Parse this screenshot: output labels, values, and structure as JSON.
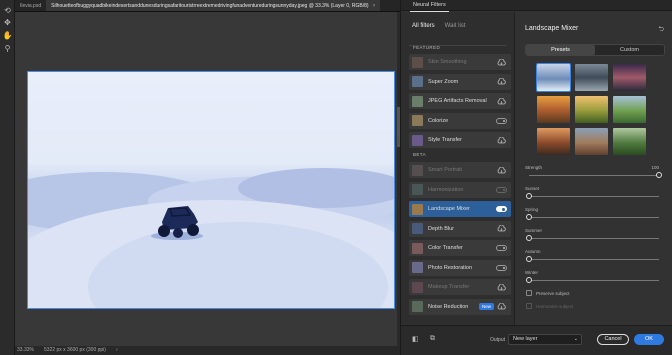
{
  "document": {
    "tabs": [
      {
        "label": "Ilevia.psd"
      },
      {
        "label": "Silhouetteofbuggyquadbikeindesertsanddunesduringsafaritouristrreextremedrivingfunadventureduringsunnyday.jpeg @ 33.3% (Layer 0, RGB/8)",
        "close": "×"
      }
    ],
    "status": {
      "zoom": "33.33%",
      "size": "5322 px x 3600 px (300 ppi)"
    }
  },
  "tools": [
    "canvas-rotate-icon",
    "move-icon",
    "hand-icon",
    "zoom-icon"
  ],
  "panel": {
    "tab": "Neural Filters",
    "list_tabs": {
      "all": "All filters",
      "wait": "Wait list"
    },
    "featured_header": "FEATURED",
    "beta_header": "BETA",
    "featured": [
      {
        "label": "Skin Smoothing",
        "dim": true,
        "control": "cloud"
      },
      {
        "label": "Super Zoom",
        "dim": false,
        "control": "cloud"
      },
      {
        "label": "JPEG Artifacts Removal",
        "dim": false,
        "control": "cloud"
      },
      {
        "label": "Colorize",
        "dim": false,
        "control": "toggle-off"
      },
      {
        "label": "Style Transfer",
        "dim": false,
        "control": "cloud"
      }
    ],
    "beta": [
      {
        "label": "Smart Portrait",
        "dim": true,
        "control": "cloud"
      },
      {
        "label": "Harmonization",
        "dim": true,
        "control": "toggle-off"
      },
      {
        "label": "Landscape Mixer",
        "dim": false,
        "control": "toggle-on",
        "selected": true
      },
      {
        "label": "Depth Blur",
        "dim": false,
        "control": "cloud"
      },
      {
        "label": "Color Transfer",
        "dim": false,
        "control": "toggle-off"
      },
      {
        "label": "Photo Restoration",
        "dim": false,
        "control": "toggle-off"
      },
      {
        "label": "Makeup Transfer",
        "dim": true,
        "control": "cloud"
      },
      {
        "label": "Noise Reduction",
        "dim": false,
        "control": "badge",
        "badge": "New"
      }
    ]
  },
  "settings": {
    "title": "Landscape Mixer",
    "segments": {
      "presets": "Presets",
      "custom": "Custom"
    },
    "presets_selected": 0,
    "sliders": [
      {
        "label": "Strength",
        "value": "100",
        "level": 1.0
      },
      {
        "label": "Sunset",
        "value": "",
        "level": 0.0
      },
      {
        "label": "Spring",
        "value": "",
        "level": 0.0
      },
      {
        "label": "Summer",
        "value": "",
        "level": 0.0
      },
      {
        "label": "Autumn",
        "value": "",
        "level": 0.0
      },
      {
        "label": "Winter",
        "value": "",
        "level": 0.0
      }
    ],
    "checkboxes": [
      {
        "label": "Preserve subject",
        "checked": false
      },
      {
        "label": "Harmonize subject",
        "checked": false,
        "disabled": true
      }
    ]
  },
  "bottom": {
    "output_label": "Output",
    "output_value": "New layer",
    "cancel": "Cancel",
    "ok": "OK"
  }
}
